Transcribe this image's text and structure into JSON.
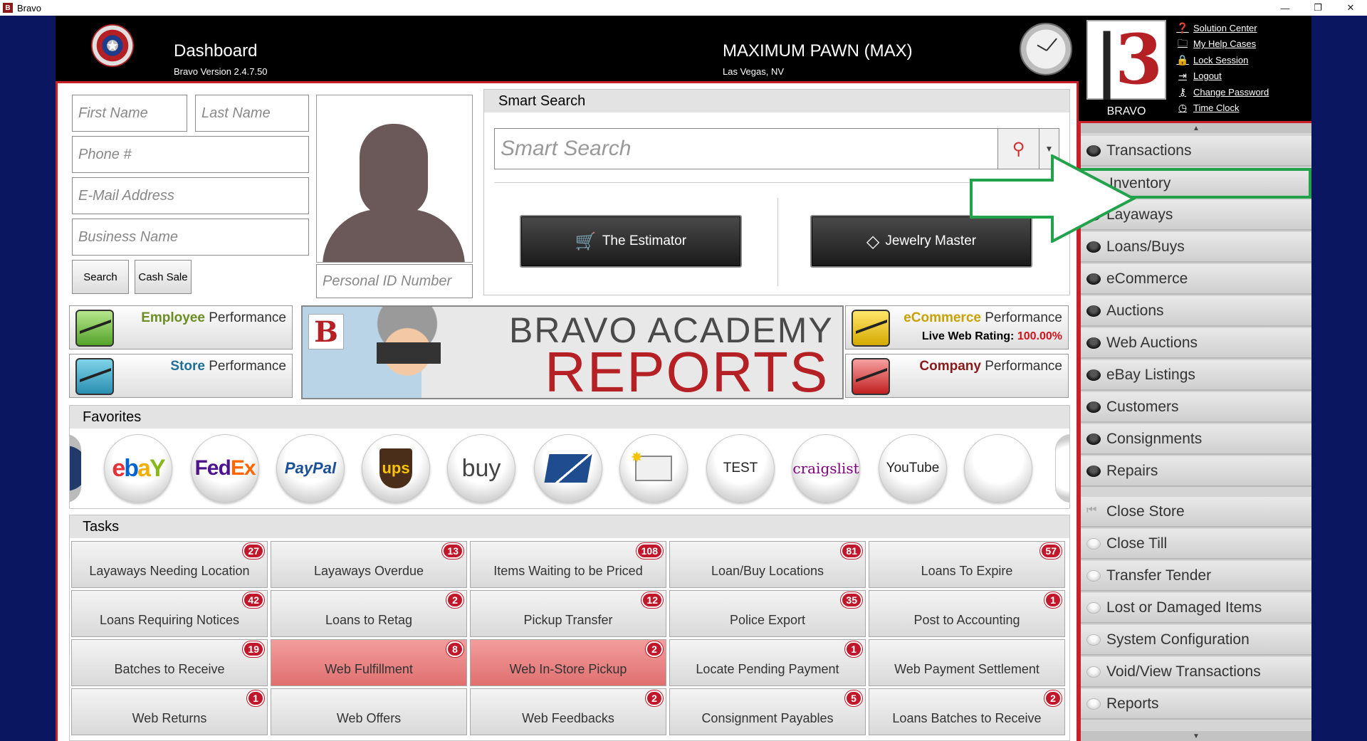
{
  "window": {
    "title": "Bravo",
    "icon_letter": "B",
    "minimize": "—",
    "restore": "❐",
    "close": "✕"
  },
  "header": {
    "title": "Dashboard",
    "version": "Bravo Version 2.4.7.50",
    "store_name": "MAXIMUM PAWN (MAX)",
    "store_location": "Las Vegas, NV",
    "logo_label": "BRAVO"
  },
  "help_links": [
    {
      "label": "Solution Center",
      "icon": "question-circle-icon"
    },
    {
      "label": "My Help Cases",
      "icon": "folder-icon"
    },
    {
      "label": "Lock Session",
      "icon": "lock-icon"
    },
    {
      "label": "Logout",
      "icon": "logout-icon"
    },
    {
      "label": "Change Password",
      "icon": "key-icon"
    },
    {
      "label": "Time Clock",
      "icon": "clock-icon"
    }
  ],
  "customer": {
    "first_name_placeholder": "First Name",
    "last_name_placeholder": "Last Name",
    "phone_placeholder": "Phone #",
    "email_placeholder": "E-Mail Address",
    "business_placeholder": "Business Name",
    "search_label": "Search",
    "cash_sale_label": "Cash Sale",
    "personal_id_placeholder": "Personal ID Number"
  },
  "smart_search": {
    "header": "Smart Search",
    "placeholder": "Smart Search",
    "estimator_label": "The Estimator",
    "jewelry_label": "Jewelry Master"
  },
  "performance": {
    "employee": {
      "bold": "Employee",
      "rest": " Performance"
    },
    "store": {
      "bold": "Store",
      "rest": " Performance"
    },
    "ecommerce": {
      "bold": "eCommerce",
      "rest": " Performance",
      "rating_label": "Live Web Rating:",
      "rating_value": "100.00%"
    },
    "company": {
      "bold": "Company",
      "rest": " Performance"
    }
  },
  "banner": {
    "line1": "BRAVO ACADEMY",
    "line2": "REPORTS"
  },
  "favorites": {
    "header": "Favorites",
    "items": [
      {
        "name": "ebay"
      },
      {
        "name": "fedex"
      },
      {
        "name": "paypal",
        "label": "PayPal"
      },
      {
        "name": "ups",
        "label": "ups"
      },
      {
        "name": "buy",
        "label": "buy"
      },
      {
        "name": "usps"
      },
      {
        "name": "mail"
      },
      {
        "name": "test",
        "label": "TEST"
      },
      {
        "name": "craigslist",
        "label": "craigslist"
      },
      {
        "name": "youtube",
        "label": "YouTube"
      },
      {
        "name": "blank",
        "label": ""
      }
    ]
  },
  "tasks": {
    "header": "Tasks",
    "items": [
      {
        "label": "Layaways Needing Location",
        "count": "27"
      },
      {
        "label": "Layaways Overdue",
        "count": "13"
      },
      {
        "label": "Items Waiting to be Priced",
        "count": "108"
      },
      {
        "label": "Loan/Buy Locations",
        "count": "81"
      },
      {
        "label": "Loans To Expire",
        "count": "57"
      },
      {
        "label": "Loans Requiring Notices",
        "count": "42"
      },
      {
        "label": "Loans to Retag",
        "count": "2"
      },
      {
        "label": "Pickup Transfer",
        "count": "12"
      },
      {
        "label": "Police Export",
        "count": "35"
      },
      {
        "label": "Post to Accounting",
        "count": "1"
      },
      {
        "label": "Batches to Receive",
        "count": "19"
      },
      {
        "label": "Web Fulfillment",
        "count": "8",
        "highlight": true
      },
      {
        "label": "Web In-Store Pickup",
        "count": "2",
        "highlight": true
      },
      {
        "label": "Locate Pending Payment",
        "count": "1"
      },
      {
        "label": "Web Payment Settlement",
        "count": ""
      },
      {
        "label": "Web Returns",
        "count": "1"
      },
      {
        "label": "Web Offers",
        "count": ""
      },
      {
        "label": "Web Feedbacks",
        "count": "2"
      },
      {
        "label": "Consignment Payables",
        "count": "5"
      },
      {
        "label": "Loans Batches to Receive",
        "count": "2"
      }
    ]
  },
  "menu": {
    "primary": [
      {
        "label": "Transactions"
      },
      {
        "label": "Inventory",
        "selected": true
      },
      {
        "label": "Layaways"
      },
      {
        "label": "Loans/Buys"
      },
      {
        "label": "eCommerce"
      },
      {
        "label": "Auctions"
      },
      {
        "label": "Web Auctions"
      },
      {
        "label": "eBay Listings"
      },
      {
        "label": "Customers"
      },
      {
        "label": "Consignments"
      },
      {
        "label": "Repairs"
      }
    ],
    "secondary": [
      {
        "label": "Close Store"
      },
      {
        "label": "Close Till"
      },
      {
        "label": "Transfer Tender"
      },
      {
        "label": "Lost or Damaged Items"
      },
      {
        "label": "System Configuration"
      },
      {
        "label": "Void/View Transactions"
      },
      {
        "label": "Reports"
      }
    ]
  },
  "colors": {
    "accent_red": "#c8202b",
    "highlight_green": "#22a24a",
    "badge_red": "#c0182a",
    "rating_red": "#d0141e"
  }
}
